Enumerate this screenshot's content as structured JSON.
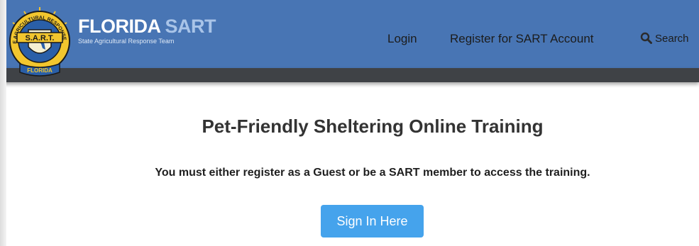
{
  "header": {
    "brand_word1": "FLORIDA",
    "brand_word2": "SART",
    "subtitle": "State Agricultural Response Team",
    "seal": {
      "top_text": "STATE AGRICULTURAL RESPONSE TEAM",
      "banner_text": "S.A.R.T.",
      "bottom_text": "FLORIDA"
    }
  },
  "nav": {
    "login": "Login",
    "register": "Register for SART Account",
    "search": "Search"
  },
  "main": {
    "title": "Pet-Friendly Sheltering Online Training",
    "notice": "You must either register as a Guest or be a SART member to access the training.",
    "signin_label": "Sign In Here"
  },
  "colors": {
    "header_bg": "#4875b4",
    "dark_bar": "#3f4246",
    "button_bg": "#45a3ec",
    "brand_accent": "#a9c4e8"
  }
}
